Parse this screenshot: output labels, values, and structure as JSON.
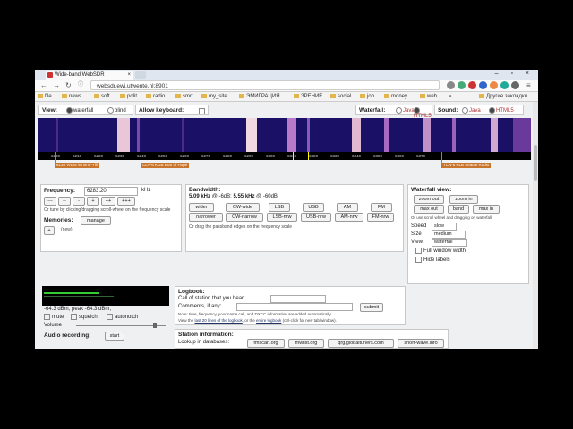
{
  "browser": {
    "tab_title": "Wide-band WebSDR",
    "tab_close": "×",
    "window_controls": "– ▫ ×",
    "url": "websdr.ewi.utwente.nl:8901",
    "bookmarks": [
      "file",
      "news",
      "soft",
      "polit",
      "radio",
      "smrt",
      "my_site",
      "ЭМИГРАЦИЯ",
      "ЗРЕНИЕ",
      "social",
      "job",
      "money",
      "web"
    ],
    "bookmarks_more": "»",
    "other_bookmarks": "Другие закладки"
  },
  "top": {
    "view_label": "View:",
    "view_options": [
      "waterfall",
      "blind"
    ],
    "keyboard_label": "Allow keyboard:",
    "waterfall_label": "Waterfall:",
    "waterfall_options": [
      "Java",
      "HTML5"
    ],
    "sound_label": "Sound:",
    "sound_options": [
      "Java",
      "HTML5"
    ]
  },
  "scale": {
    "ticks": [
      "6200",
      "6210",
      "6220",
      "6230",
      "6240",
      "6250",
      "6260",
      "6270",
      "6280",
      "6290",
      "6300",
      "6310",
      "6320",
      "6330",
      "6340",
      "6350",
      "6360",
      "6370"
    ],
    "stations": [
      {
        "label": "6135 VNJS Wnnnn-Yfff"
      },
      {
        "label": "CLA-6 KGB Erar of Hope"
      },
      {
        "label": "TCN-6 KLB Seattle Radio"
      }
    ]
  },
  "frequency": {
    "label": "Frequency:",
    "value": "6283.20",
    "unit": "kHz",
    "buttons": [
      "---",
      "--",
      "-",
      "+",
      "++",
      "+++"
    ],
    "hint": "Or tune by clicking/dragging scroll-wheel on the frequency scale"
  },
  "memories": {
    "label": "Memories:",
    "manage": "manage",
    "add": "+",
    "new": "(new)"
  },
  "bandwidth": {
    "label": "Bandwidth:",
    "value_6db": "5.09 kHz",
    "at_6db": "@ -6dB;",
    "value_60db": "5.55 kHz",
    "at_60db": "@ -60dB",
    "row1": [
      "wider",
      "CW-wide",
      "LSB",
      "USB",
      "AM",
      "FM"
    ],
    "row2": [
      "narrower",
      "CW-narrow",
      "LSB-nrw",
      "USB-nrw",
      "AM-nrw",
      "FM-nrw"
    ],
    "hint": "Or drag the passband edges on the frequency scale"
  },
  "waterfall_view": {
    "label": "Waterfall view:",
    "row1": [
      "zoom out",
      "zoom in"
    ],
    "row2": [
      "max out",
      "band",
      "max in"
    ],
    "hint": "Or use scroll wheel and dragging on waterfall",
    "speed_label": "Speed",
    "speed": "slow",
    "size_label": "Size",
    "size": "medium",
    "view_label": "View",
    "view": "waterfall",
    "full_window": "Full window width",
    "hide_labels": "Hide labels"
  },
  "signal": {
    "readout": "-64.3 dBm, peak  -64.3 dBm,",
    "mute": "mute",
    "squelch": "squelch",
    "autonotch": "autonotch",
    "volume_label": "Volume",
    "volume_level": 0.9,
    "audio_label": "Audio recording:",
    "start": "start"
  },
  "logbook": {
    "label": "Logbook:",
    "call_label": "Call of station that you hear:",
    "comments_label": "Comments, if any:",
    "submit": "submit",
    "note": "Note: time, frequency, your name call, and DXCC information are added automatically.",
    "view_prefix": "View the",
    "view_link1": "last 20 lines of the logbook",
    "view_mid": ", or the",
    "view_link2": "entire logbook",
    "view_suffix": "(ctrl-click for new tab/window)."
  },
  "station_info": {
    "label": "Station information:",
    "lookup_label": "Lookup in databases:",
    "links": [
      "fmscan.org",
      "mwlist.org",
      "qrg.globaltuners.com",
      "short-wave.info"
    ]
  }
}
